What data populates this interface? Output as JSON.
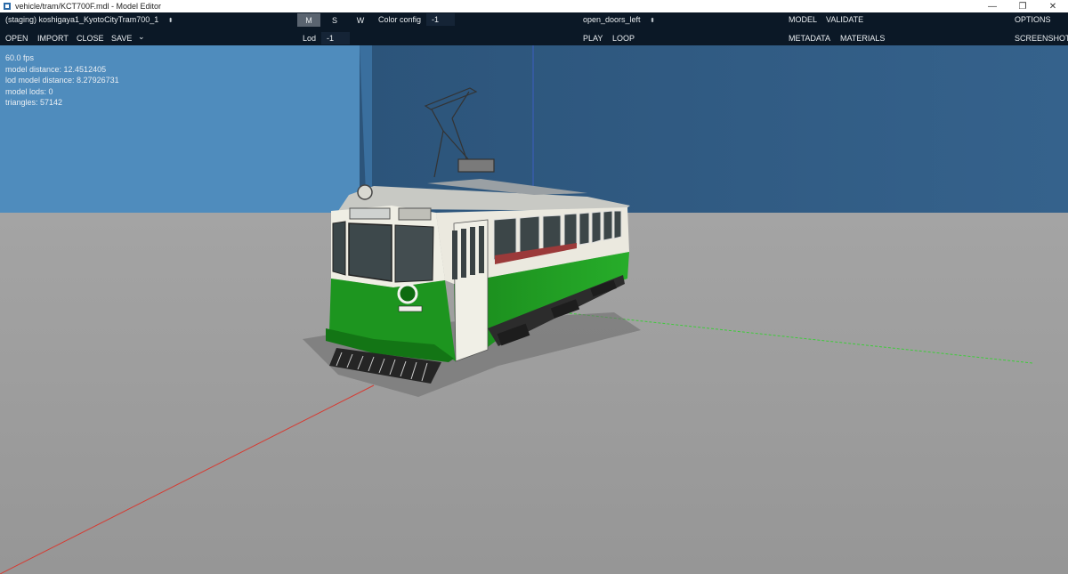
{
  "window": {
    "title": "vehicle/tram/KCT700F.mdl - Model Editor",
    "controls": {
      "minimize": "—",
      "maximize": "❐",
      "close": "✕"
    }
  },
  "toolbar": {
    "model_select": "(staging) koshigaya1_KyotoCityTram700_1",
    "open": "OPEN",
    "import": "IMPORT",
    "close": "CLOSE",
    "save": "SAVE",
    "save_more": "⌄",
    "modes": {
      "m": "M",
      "s": "S",
      "w": "W"
    },
    "color_config_label": "Color config",
    "color_config_value": "-1",
    "lod_label": "Lod",
    "lod_value": "-1",
    "animation_select": "open_doors_left",
    "play": "PLAY",
    "loop": "LOOP",
    "model": "MODEL",
    "validate": "VALIDATE",
    "metadata": "METADATA",
    "materials": "MATERIALS",
    "options": "OPTIONS",
    "screenshot": "SCREENSHOT"
  },
  "stats": {
    "fps": "60.0 fps",
    "model_distance": "model distance: 12.4512405",
    "lod_model_distance": "lod model distance: 8.27926731",
    "model_lods": "model lods: 0",
    "triangles": "triangles: 57142"
  },
  "colors": {
    "toolbar_bg": "#0b1826",
    "sky_light": "#4f8cbd",
    "sky_dark": "#2d5479",
    "ground": "#9c9c9c",
    "tram_green": "#1f9a22",
    "tram_cream": "#ecebe0"
  }
}
